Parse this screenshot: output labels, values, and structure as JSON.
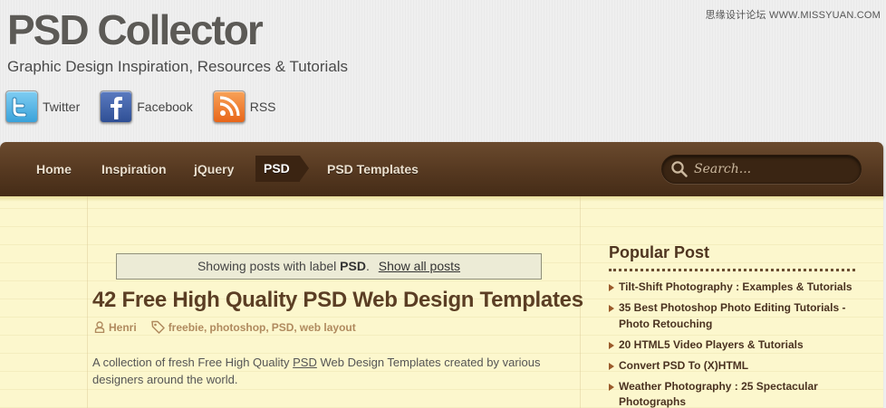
{
  "watermark": "思缘设计论坛 WWW.MISSYUAN.COM",
  "header": {
    "site_title": "PSD Collector",
    "tagline": "Graphic Design Inspiration, Resources & Tutorials"
  },
  "social": [
    {
      "label": "Twitter",
      "icon": "twitter-icon",
      "color": "#4fb3e8"
    },
    {
      "label": "Facebook",
      "icon": "facebook-icon",
      "color": "#3b5998"
    },
    {
      "label": "RSS",
      "icon": "rss-icon",
      "color": "#f47a20"
    }
  ],
  "nav": {
    "items": [
      {
        "label": "Home"
      },
      {
        "label": "Inspiration"
      },
      {
        "label": "jQuery"
      },
      {
        "label": "PSD",
        "active": true
      },
      {
        "label": "PSD Templates"
      }
    ],
    "search_placeholder": "Search..."
  },
  "main": {
    "label_notice": {
      "prefix": "Showing posts with label",
      "label": "PSD",
      "suffix": ".",
      "link": "Show all posts"
    },
    "post": {
      "title": "42 Free High Quality PSD Web Design Templates",
      "author": "Henri",
      "tags": [
        "freebie",
        "photoshop",
        "PSD",
        "web layout"
      ],
      "excerpt_before": "A collection of fresh Free High Quality",
      "excerpt_link": "PSD",
      "excerpt_after": "Web Design Templates created by various designers around the world."
    }
  },
  "sidebar": {
    "title": "Popular Post",
    "items": [
      "Tilt-Shift Photography : Examples & Tutorials",
      "35 Best Photoshop Photo Editing Tutorials - Photo Retouching",
      "20 HTML5 Video Players & Tutorials",
      "Convert PSD To (X)HTML",
      "Weather Photography : 25 Spectacular Photographs"
    ]
  },
  "colors": {
    "nav_brown": "#553820",
    "content_bg": "#fcf7cd",
    "title_brown": "#5b3e24",
    "meta_tan": "#b08a5e"
  }
}
